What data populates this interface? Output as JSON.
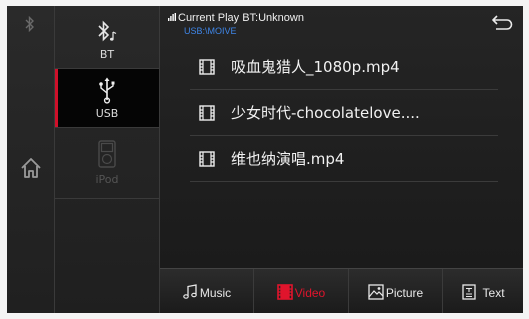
{
  "colors": {
    "accent_red": "#d0102a",
    "path_blue": "#3f86e8",
    "background": "#1d1d1d"
  },
  "rail": {
    "bt_indicator_icon": "bluetooth-icon",
    "home_icon": "home-icon"
  },
  "sources": [
    {
      "label": "BT",
      "icon": "bluetooth-music-icon",
      "active": false
    },
    {
      "label": "USB",
      "icon": "usb-icon",
      "active": true
    },
    {
      "label": "iPod",
      "icon": "ipod-icon",
      "active": false,
      "disabled": true
    }
  ],
  "header": {
    "current_play": "Current Play BT:Unknown",
    "path": "USB:\\MOIVE",
    "back_icon": "back-icon"
  },
  "files": [
    {
      "name": "吸血鬼猎人_1080p.mp4",
      "icon": "film-icon"
    },
    {
      "name": "少女时代-chocolatelove....",
      "icon": "film-icon"
    },
    {
      "name": "维也纳演唱.mp4",
      "icon": "film-icon"
    }
  ],
  "tabs": [
    {
      "label": "Music",
      "icon": "music-note-icon",
      "active": false
    },
    {
      "label": "Video",
      "icon": "film-icon",
      "active": true
    },
    {
      "label": "Picture",
      "icon": "picture-icon",
      "active": false
    },
    {
      "label": "Text",
      "icon": "text-document-icon",
      "active": false
    }
  ]
}
